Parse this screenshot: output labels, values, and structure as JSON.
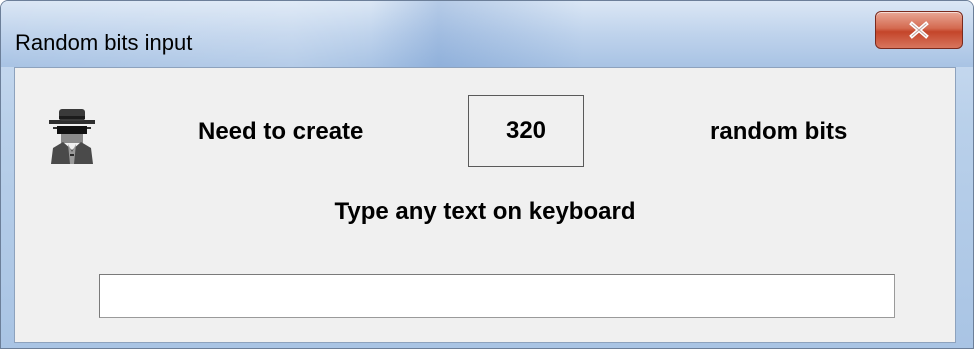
{
  "window": {
    "title": "Random bits input"
  },
  "titlebar": {
    "close_icon": "close-x-icon"
  },
  "main": {
    "icon": "spy-agent-icon",
    "need_label": "Need to create",
    "bits_count": "320",
    "bits_label": "random bits",
    "instruction": "Type any text on keyboard",
    "text_input_value": ""
  },
  "colors": {
    "close_button": "#c4452a",
    "client_background": "#f0f0f0"
  }
}
